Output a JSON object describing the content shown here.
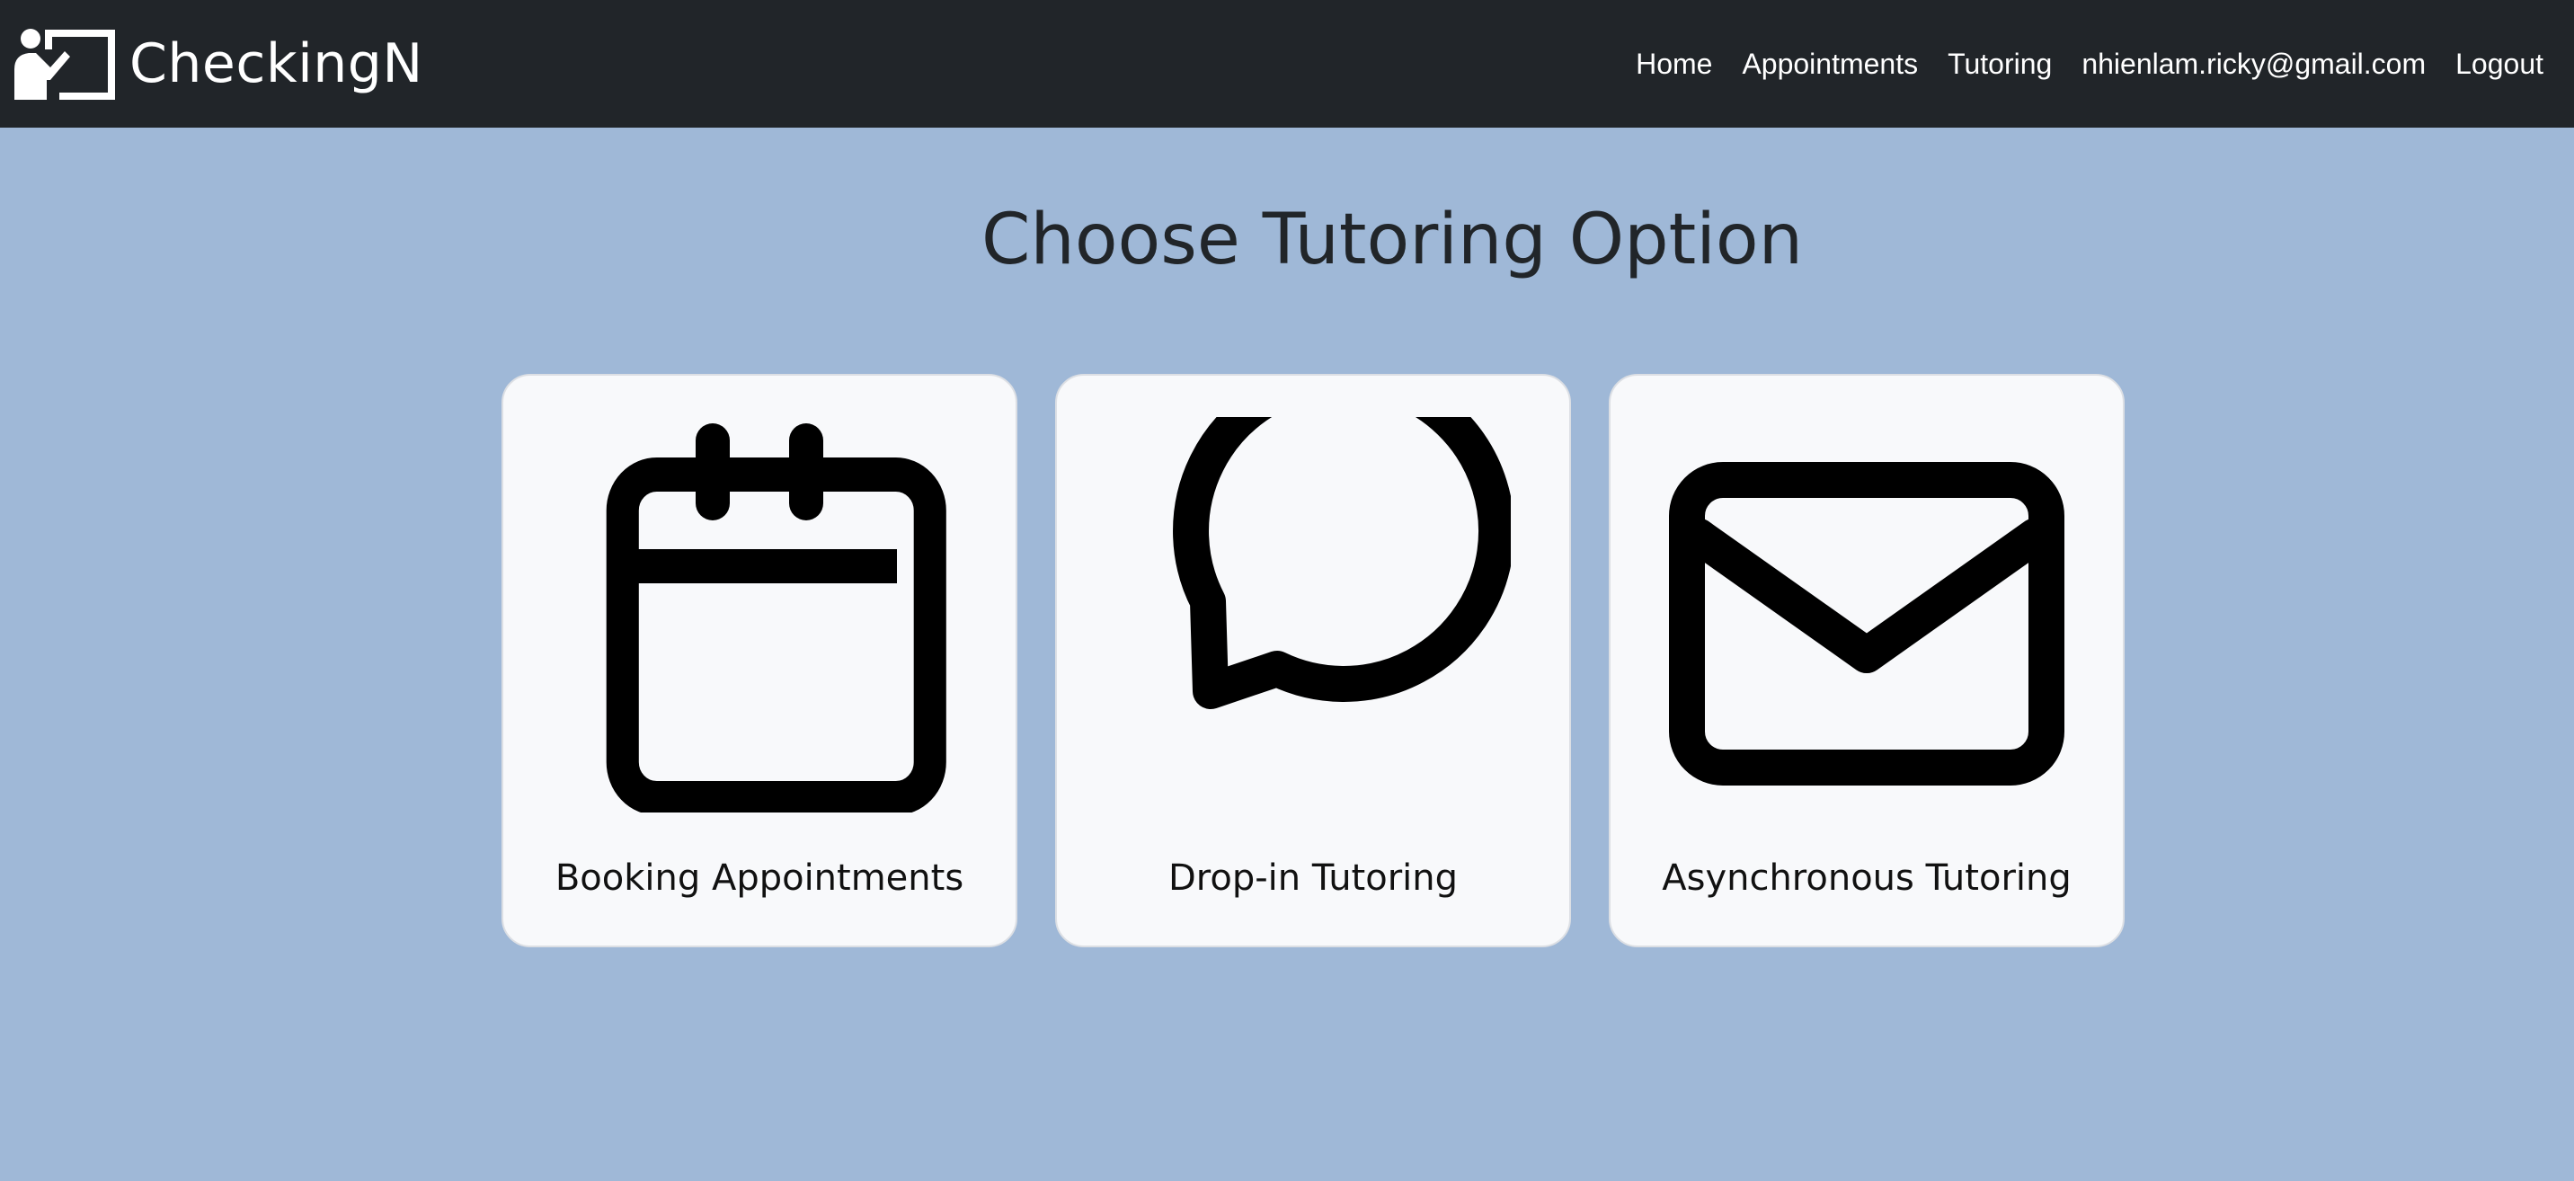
{
  "app": {
    "name": "CheckingN"
  },
  "nav": {
    "links": [
      {
        "label": "Home"
      },
      {
        "label": "Appointments"
      },
      {
        "label": "Tutoring"
      },
      {
        "label": "nhienlam.ricky@gmail.com"
      },
      {
        "label": "Logout"
      }
    ]
  },
  "main": {
    "title": "Choose Tutoring Option",
    "options": [
      {
        "label": "Booking Appointments",
        "icon": "calendar-icon"
      },
      {
        "label": "Drop-in Tutoring",
        "icon": "chat-bubble-icon"
      },
      {
        "label": "Asynchronous Tutoring",
        "icon": "envelope-icon"
      }
    ]
  },
  "colors": {
    "navbar": "#212529",
    "background": "#9fb8d7",
    "card": "#f8f9fb",
    "text": "#212529"
  }
}
